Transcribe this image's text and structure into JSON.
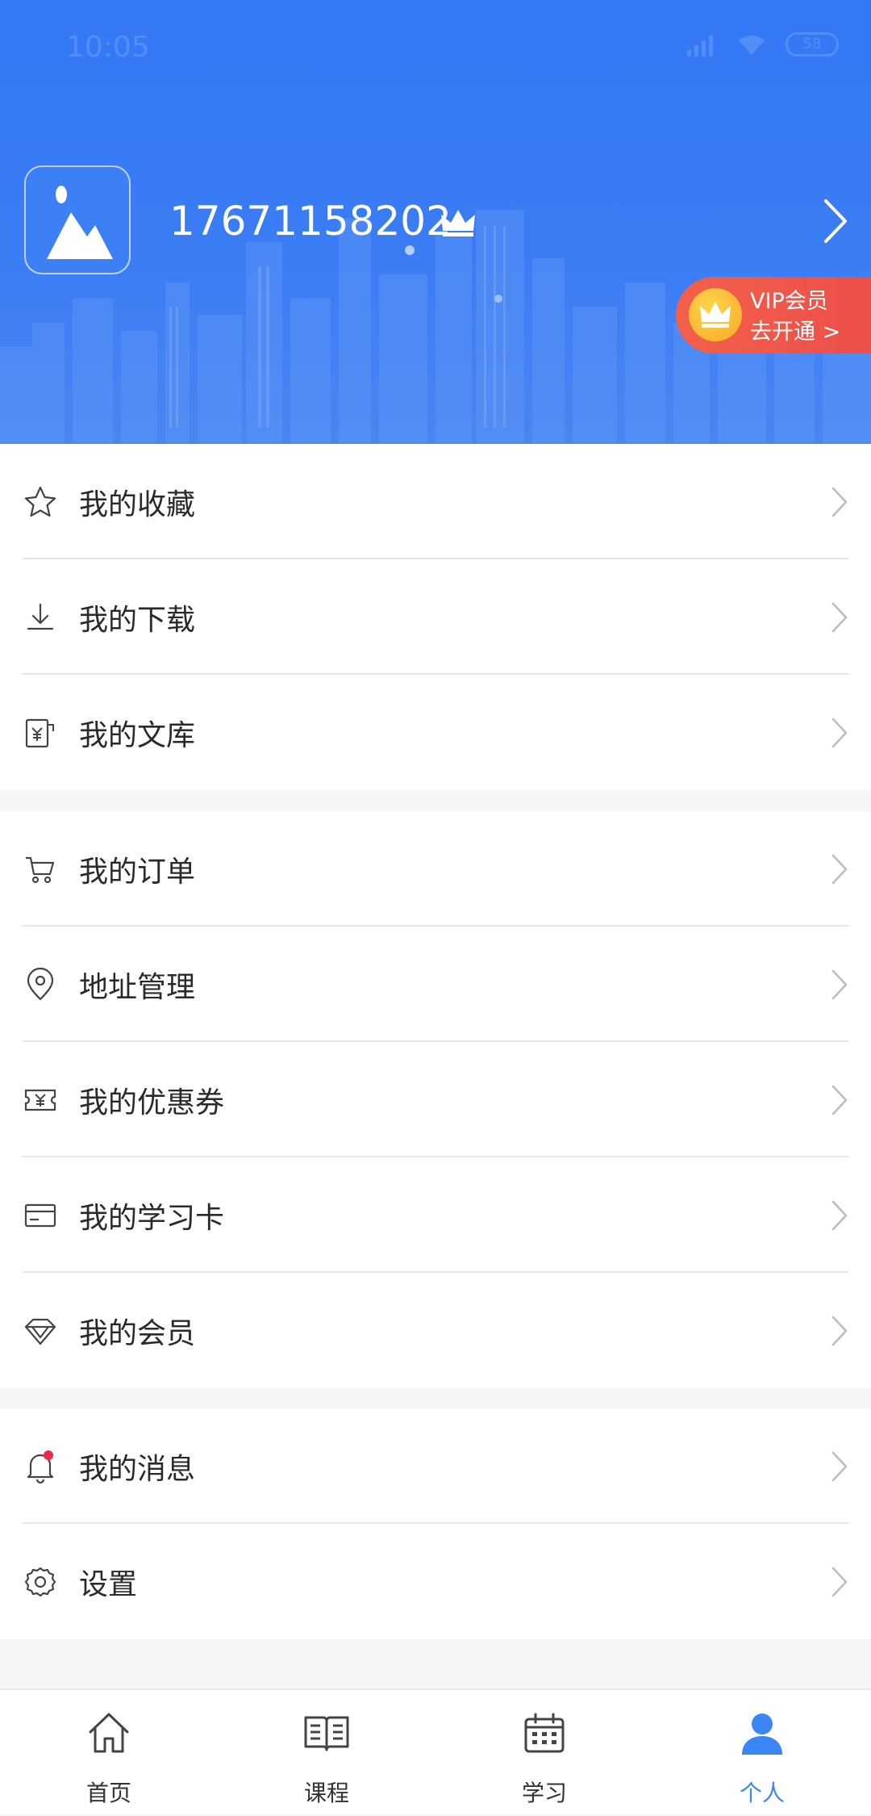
{
  "status_bar": {
    "time": "10:05",
    "battery": "58"
  },
  "profile": {
    "username": "17671158202",
    "vip": {
      "line1": "VIP会员",
      "line2": "去开通 >"
    }
  },
  "menu_groups": [
    [
      {
        "label": "我的收藏",
        "icon": "star-icon"
      },
      {
        "label": "我的下载",
        "icon": "download-icon"
      },
      {
        "label": "我的文库",
        "icon": "library-icon"
      }
    ],
    [
      {
        "label": "我的订单",
        "icon": "cart-icon"
      },
      {
        "label": "地址管理",
        "icon": "location-pin-icon"
      },
      {
        "label": "我的优惠券",
        "icon": "coupon-icon"
      },
      {
        "label": "我的学习卡",
        "icon": "card-icon"
      },
      {
        "label": "我的会员",
        "icon": "diamond-icon"
      }
    ],
    [
      {
        "label": "我的消息",
        "icon": "bell-icon",
        "badge": true
      },
      {
        "label": "设置",
        "icon": "gear-icon"
      }
    ]
  ],
  "tabs": [
    {
      "label": "首页",
      "icon": "home-icon",
      "active": false
    },
    {
      "label": "课程",
      "icon": "book-icon",
      "active": false
    },
    {
      "label": "学习",
      "icon": "calendar-icon",
      "active": false
    },
    {
      "label": "个人",
      "icon": "person-icon",
      "active": true
    }
  ],
  "colors": {
    "primary": "#3478f6",
    "vip": "#ee5449",
    "badge": "#f0284a",
    "tab_active": "#3a86f4"
  }
}
